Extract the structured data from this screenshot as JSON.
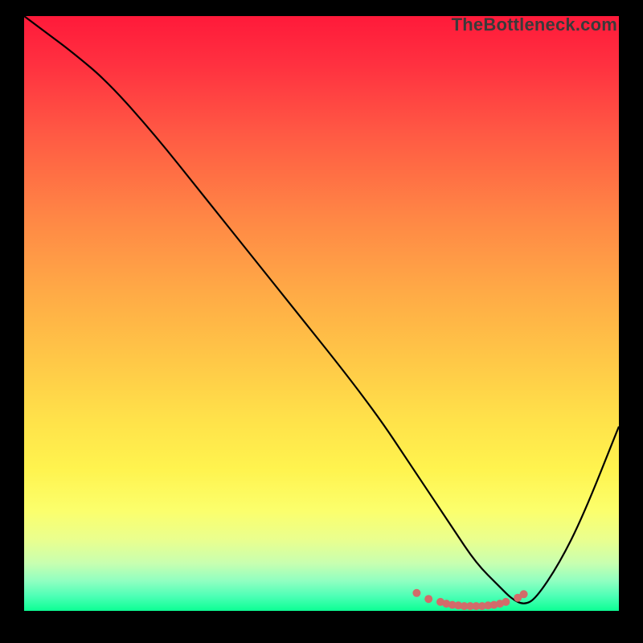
{
  "brand": "TheBottleneck.com",
  "colors": {
    "brand_text": "#3a3a3a",
    "curve_stroke": "#000000",
    "tick_fill": "#d26b6a",
    "gradient_top": "#ff1a3a",
    "gradient_bottom": "#0cff94"
  },
  "chart_data": {
    "type": "line",
    "title": "",
    "xlabel": "",
    "ylabel": "",
    "xlim": [
      0,
      100
    ],
    "ylim": [
      0,
      100
    ],
    "grid": false,
    "legend": false,
    "series": [
      {
        "name": "bottleneck-curve",
        "x": [
          0,
          4,
          8,
          14,
          22,
          30,
          38,
          46,
          54,
          60,
          64,
          68,
          72,
          76,
          80,
          82,
          84,
          86,
          90,
          94,
          100
        ],
        "values": [
          100,
          97,
          94,
          89,
          80,
          70,
          60,
          50,
          40,
          32,
          26,
          20,
          14,
          8,
          4,
          2,
          1,
          2,
          8,
          16,
          31
        ]
      }
    ],
    "tick_marks": {
      "x": [
        66,
        68,
        70,
        71,
        72,
        73,
        74,
        75,
        76,
        77,
        78,
        79,
        80,
        81,
        83,
        84
      ],
      "values": [
        3,
        2,
        1.5,
        1.2,
        1.0,
        0.9,
        0.8,
        0.8,
        0.8,
        0.8,
        0.9,
        1.0,
        1.2,
        1.5,
        2.2,
        2.8
      ]
    }
  }
}
